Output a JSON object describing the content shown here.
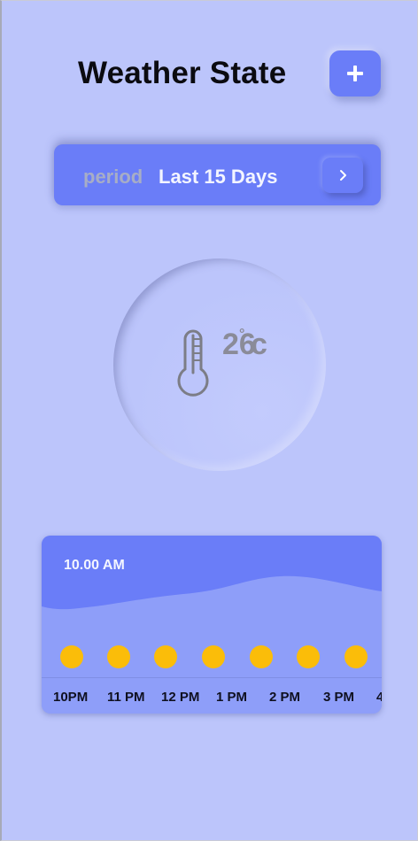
{
  "header": {
    "title": "Weather State",
    "add_icon": "plus-icon"
  },
  "period": {
    "label": "period",
    "value": "Last 15 Days",
    "next_icon": "chevron-right-icon"
  },
  "current": {
    "icon": "thermometer-icon",
    "temperature": "26",
    "degree_symbol": "°",
    "unit": "c"
  },
  "forecast": {
    "current_time": "10.00 AM",
    "hours": [
      "10PM",
      "11 PM",
      "12 PM",
      "1 PM",
      "2 PM",
      "3 PM",
      "4"
    ],
    "condition_icon": "sun-icon"
  },
  "colors": {
    "background": "#bcc5fb",
    "accent": "#6a7df8",
    "sun": "#fbbd09"
  }
}
